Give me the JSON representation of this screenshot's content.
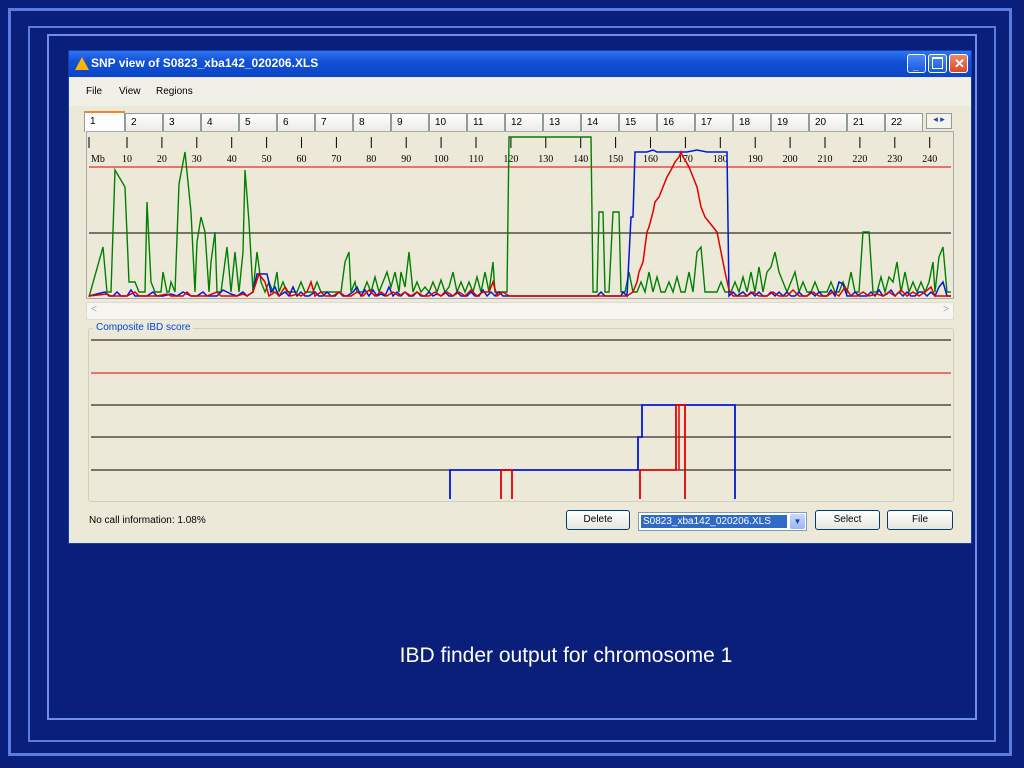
{
  "window": {
    "title": "SNP view of S0823_xba142_020206.XLS",
    "menu": [
      "File",
      "View",
      "Regions"
    ]
  },
  "tabs": [
    "1",
    "2",
    "3",
    "4",
    "5",
    "6",
    "7",
    "8",
    "9",
    "10",
    "11",
    "12",
    "13",
    "14",
    "15",
    "16",
    "17",
    "18",
    "19",
    "20",
    "21",
    "22"
  ],
  "tab_arrows": "◂ ▸",
  "axis": {
    "unit_label": "Mb",
    "ticks": [
      "10",
      "20",
      "30",
      "40",
      "50",
      "60",
      "70",
      "80",
      "90",
      "100",
      "110",
      "120",
      "130",
      "140",
      "150",
      "160",
      "170",
      "180",
      "190",
      "200",
      "210",
      "220",
      "230",
      "240"
    ]
  },
  "composite": {
    "label": "Composite IBD score"
  },
  "footer": {
    "status": "No call information: 1.08%",
    "delete_label": "Delete",
    "file_selected": "S0823_xba142_020206.XLS",
    "select_label": "Select",
    "file_label": "File"
  },
  "colors": {
    "green_series": "#008000",
    "red_series": "#e00000",
    "blue_series": "#0018d8",
    "threshold_line": "#e00000",
    "grid_line": "#000000"
  },
  "caption": "IBD finder output for chromosome 1"
}
